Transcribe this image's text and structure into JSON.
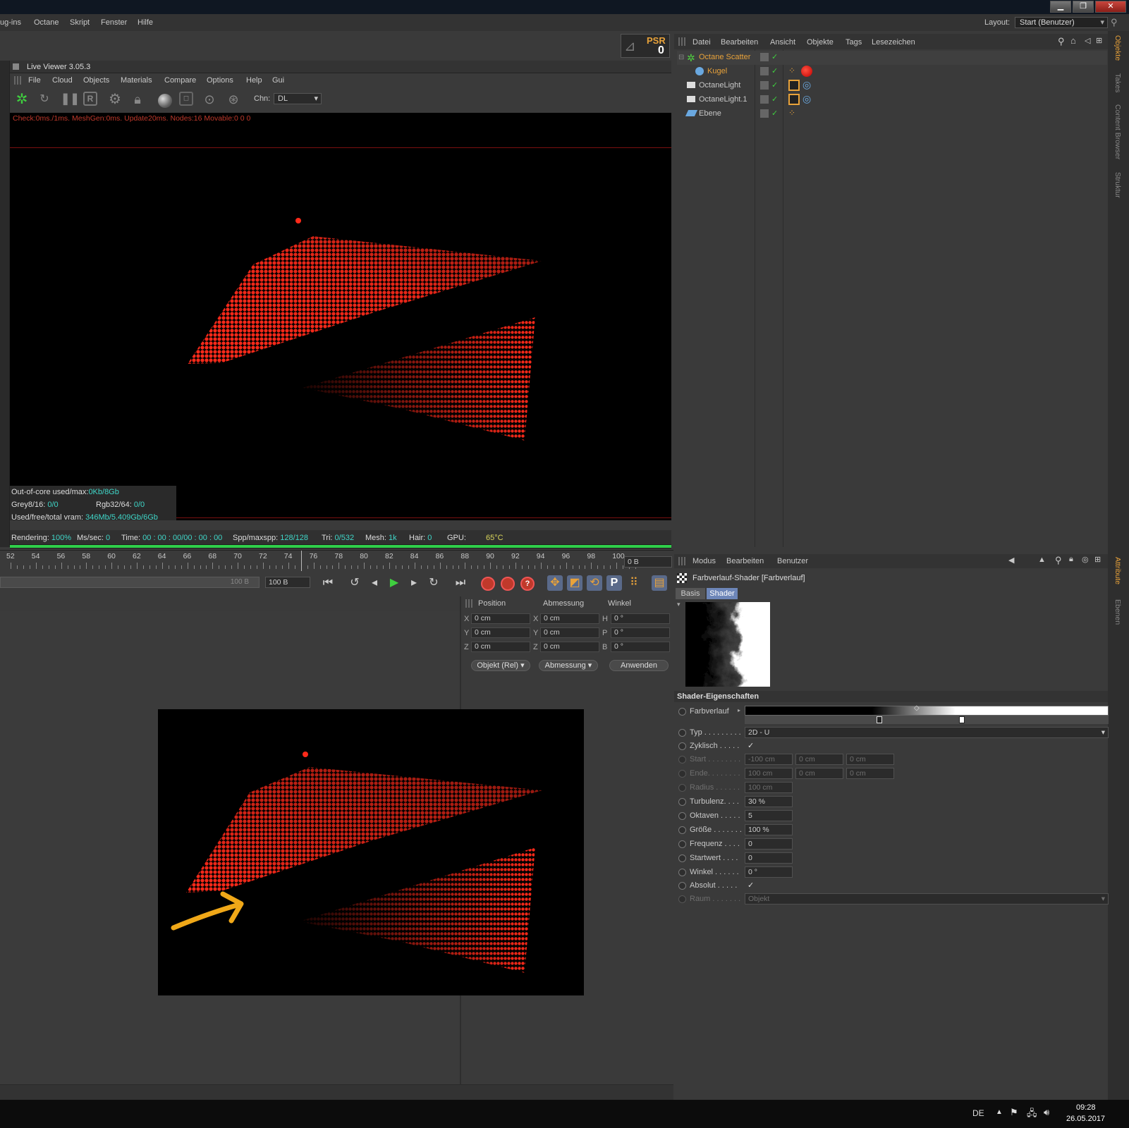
{
  "menubar": {
    "items": [
      "ug-ins",
      "Octane",
      "Skript",
      "Fenster",
      "Hilfe"
    ],
    "layout_label": "Layout:",
    "layout_value": "Start (Benutzer)"
  },
  "psr": {
    "label": "PSR",
    "value": "0"
  },
  "live_viewer": {
    "title": "Live Viewer 3.05.3",
    "menu": [
      "File",
      "Cloud",
      "Objects",
      "Materials",
      "Compare",
      "Options",
      "Help",
      "Gui"
    ],
    "chn_label": "Chn:",
    "chn_value": "DL",
    "debug_text": "Check:0ms./1ms. MeshGen:0ms. Update20ms. Nodes:16 Movable:0  0 0",
    "stats": {
      "ooc_label": "Out-of-core used/max:",
      "ooc_value": "0Kb/8Gb",
      "grey_label": "Grey8/16:",
      "grey_value": "0/0",
      "rgb_label": "Rgb32/64:",
      "rgb_value": "0/0",
      "vram_label": "Used/free/total vram:",
      "vram_value": "346Mb/5.409Gb/6Gb"
    },
    "status": {
      "rendering_label": "Rendering:",
      "rendering_value": "100%",
      "ms_label": "Ms/sec:",
      "ms_value": "0",
      "time_label": "Time:",
      "time_value": "00 : 00 : 00/00 : 00 : 00",
      "spp_label": "Spp/maxspp:",
      "spp_value": "128/128",
      "tri_label": "Tri:",
      "tri_value": "0/532",
      "mesh_label": "Mesh:",
      "mesh_value": "1k",
      "hair_label": "Hair:",
      "hair_value": "0",
      "gpu_label": "GPU:",
      "gpu_value": "65°C"
    },
    "progress": 1.0
  },
  "timeline": {
    "ticks": [
      "52",
      "54",
      "56",
      "58",
      "60",
      "62",
      "64",
      "66",
      "68",
      "70",
      "72",
      "74",
      "76",
      "78",
      "80",
      "82",
      "84",
      "86",
      "88",
      "90",
      "92",
      "94",
      "96",
      "98",
      "100"
    ],
    "frame_field": "0 B",
    "end_field_a": "100 B",
    "end_field_b": "100 B"
  },
  "coords": {
    "headers": [
      "Position",
      "Abmessung",
      "Winkel"
    ],
    "rows": [
      {
        "a": "X",
        "pos": "0 cm",
        "b": "X",
        "size": "0 cm",
        "c": "H",
        "rot": "0 °"
      },
      {
        "a": "Y",
        "pos": "0 cm",
        "b": "Y",
        "size": "0 cm",
        "c": "P",
        "rot": "0 °"
      },
      {
        "a": "Z",
        "pos": "0 cm",
        "b": "Z",
        "size": "0 cm",
        "c": "B",
        "rot": "0 °"
      }
    ],
    "mode_a": "Objekt (Rel)",
    "mode_b": "Abmessung",
    "apply": "Anwenden"
  },
  "object_manager": {
    "menu": [
      "Datei",
      "Bearbeiten",
      "Ansicht",
      "Objekte",
      "Tags",
      "Lesezeichen"
    ],
    "objects": [
      {
        "name": "Octane Scatter",
        "color": "#e8a23a"
      },
      {
        "name": "Kugel",
        "color": "#e8a23a"
      },
      {
        "name": "OctaneLight",
        "color": "#c8c8c8"
      },
      {
        "name": "OctaneLight.1",
        "color": "#c8c8c8"
      },
      {
        "name": "Ebene",
        "color": "#c8c8c8"
      }
    ]
  },
  "side_tabs": [
    "Objekte",
    "Takes",
    "Content Browser",
    "Struktur",
    "Attribute",
    "Ebenen"
  ],
  "attributes": {
    "menu": [
      "Modus",
      "Bearbeiten",
      "Benutzer"
    ],
    "title": "Farbverlauf-Shader [Farbverlauf]",
    "tabs": [
      "Basis",
      "Shader"
    ],
    "section": "Shader-Eigenschaften",
    "gradient_label": "Farbverlauf",
    "props": [
      {
        "label": "Typ . . . . . . . . .",
        "value": "2D - U"
      },
      {
        "label": "Zyklisch . . . . .",
        "value": "✓"
      },
      {
        "label": "Start . . . . . . . .",
        "v1": "-100 cm",
        "v2": "0 cm",
        "v3": "0 cm"
      },
      {
        "label": "Ende. . . . . . . .",
        "v1": "100 cm",
        "v2": "0 cm",
        "v3": "0 cm"
      },
      {
        "label": "Radius . . . . . .",
        "value": "100 cm"
      },
      {
        "label": "Turbulenz. . . .",
        "value": "30 %"
      },
      {
        "label": "Oktaven . . . . .",
        "value": "5"
      },
      {
        "label": "Größe . . . . . . .",
        "value": "100 %"
      },
      {
        "label": "Frequenz . . . .",
        "value": "0"
      },
      {
        "label": "Startwert . . . .",
        "value": "0"
      },
      {
        "label": "Winkel . . . . . .",
        "value": "0 °"
      },
      {
        "label": "Absolut . . . . .",
        "value": "✓"
      },
      {
        "label": "Raum . . . . . . .",
        "value": "Objekt"
      }
    ]
  },
  "taskbar": {
    "lang": "DE",
    "time": "09:28",
    "date": "26.05.2017"
  },
  "colors": {
    "accent_orange": "#e8a23a",
    "cyan": "#3fd6c8",
    "render_red": "#ff2a1a",
    "progress_green": "#2fcf4a"
  }
}
